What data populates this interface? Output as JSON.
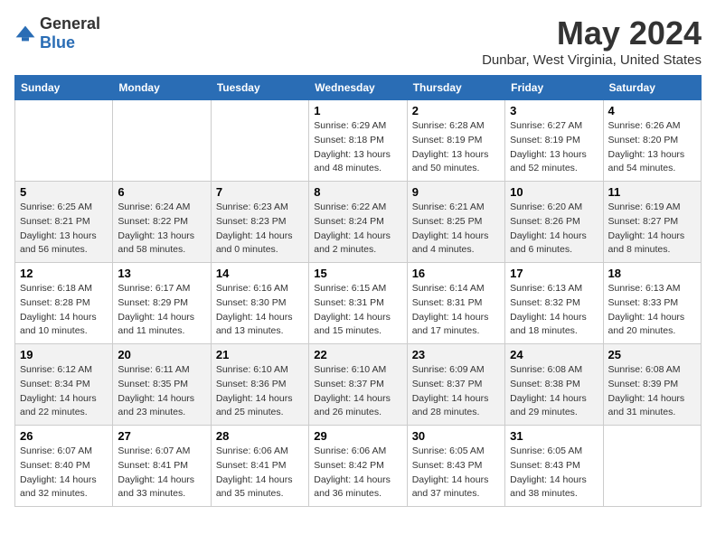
{
  "header": {
    "logo_general": "General",
    "logo_blue": "Blue",
    "title": "May 2024",
    "subtitle": "Dunbar, West Virginia, United States"
  },
  "weekdays": [
    "Sunday",
    "Monday",
    "Tuesday",
    "Wednesday",
    "Thursday",
    "Friday",
    "Saturday"
  ],
  "weeks": [
    [
      {
        "day": "",
        "sunrise": "",
        "sunset": "",
        "daylight": ""
      },
      {
        "day": "",
        "sunrise": "",
        "sunset": "",
        "daylight": ""
      },
      {
        "day": "",
        "sunrise": "",
        "sunset": "",
        "daylight": ""
      },
      {
        "day": "1",
        "sunrise": "Sunrise: 6:29 AM",
        "sunset": "Sunset: 8:18 PM",
        "daylight": "Daylight: 13 hours and 48 minutes."
      },
      {
        "day": "2",
        "sunrise": "Sunrise: 6:28 AM",
        "sunset": "Sunset: 8:19 PM",
        "daylight": "Daylight: 13 hours and 50 minutes."
      },
      {
        "day": "3",
        "sunrise": "Sunrise: 6:27 AM",
        "sunset": "Sunset: 8:19 PM",
        "daylight": "Daylight: 13 hours and 52 minutes."
      },
      {
        "day": "4",
        "sunrise": "Sunrise: 6:26 AM",
        "sunset": "Sunset: 8:20 PM",
        "daylight": "Daylight: 13 hours and 54 minutes."
      }
    ],
    [
      {
        "day": "5",
        "sunrise": "Sunrise: 6:25 AM",
        "sunset": "Sunset: 8:21 PM",
        "daylight": "Daylight: 13 hours and 56 minutes."
      },
      {
        "day": "6",
        "sunrise": "Sunrise: 6:24 AM",
        "sunset": "Sunset: 8:22 PM",
        "daylight": "Daylight: 13 hours and 58 minutes."
      },
      {
        "day": "7",
        "sunrise": "Sunrise: 6:23 AM",
        "sunset": "Sunset: 8:23 PM",
        "daylight": "Daylight: 14 hours and 0 minutes."
      },
      {
        "day": "8",
        "sunrise": "Sunrise: 6:22 AM",
        "sunset": "Sunset: 8:24 PM",
        "daylight": "Daylight: 14 hours and 2 minutes."
      },
      {
        "day": "9",
        "sunrise": "Sunrise: 6:21 AM",
        "sunset": "Sunset: 8:25 PM",
        "daylight": "Daylight: 14 hours and 4 minutes."
      },
      {
        "day": "10",
        "sunrise": "Sunrise: 6:20 AM",
        "sunset": "Sunset: 8:26 PM",
        "daylight": "Daylight: 14 hours and 6 minutes."
      },
      {
        "day": "11",
        "sunrise": "Sunrise: 6:19 AM",
        "sunset": "Sunset: 8:27 PM",
        "daylight": "Daylight: 14 hours and 8 minutes."
      }
    ],
    [
      {
        "day": "12",
        "sunrise": "Sunrise: 6:18 AM",
        "sunset": "Sunset: 8:28 PM",
        "daylight": "Daylight: 14 hours and 10 minutes."
      },
      {
        "day": "13",
        "sunrise": "Sunrise: 6:17 AM",
        "sunset": "Sunset: 8:29 PM",
        "daylight": "Daylight: 14 hours and 11 minutes."
      },
      {
        "day": "14",
        "sunrise": "Sunrise: 6:16 AM",
        "sunset": "Sunset: 8:30 PM",
        "daylight": "Daylight: 14 hours and 13 minutes."
      },
      {
        "day": "15",
        "sunrise": "Sunrise: 6:15 AM",
        "sunset": "Sunset: 8:31 PM",
        "daylight": "Daylight: 14 hours and 15 minutes."
      },
      {
        "day": "16",
        "sunrise": "Sunrise: 6:14 AM",
        "sunset": "Sunset: 8:31 PM",
        "daylight": "Daylight: 14 hours and 17 minutes."
      },
      {
        "day": "17",
        "sunrise": "Sunrise: 6:13 AM",
        "sunset": "Sunset: 8:32 PM",
        "daylight": "Daylight: 14 hours and 18 minutes."
      },
      {
        "day": "18",
        "sunrise": "Sunrise: 6:13 AM",
        "sunset": "Sunset: 8:33 PM",
        "daylight": "Daylight: 14 hours and 20 minutes."
      }
    ],
    [
      {
        "day": "19",
        "sunrise": "Sunrise: 6:12 AM",
        "sunset": "Sunset: 8:34 PM",
        "daylight": "Daylight: 14 hours and 22 minutes."
      },
      {
        "day": "20",
        "sunrise": "Sunrise: 6:11 AM",
        "sunset": "Sunset: 8:35 PM",
        "daylight": "Daylight: 14 hours and 23 minutes."
      },
      {
        "day": "21",
        "sunrise": "Sunrise: 6:10 AM",
        "sunset": "Sunset: 8:36 PM",
        "daylight": "Daylight: 14 hours and 25 minutes."
      },
      {
        "day": "22",
        "sunrise": "Sunrise: 6:10 AM",
        "sunset": "Sunset: 8:37 PM",
        "daylight": "Daylight: 14 hours and 26 minutes."
      },
      {
        "day": "23",
        "sunrise": "Sunrise: 6:09 AM",
        "sunset": "Sunset: 8:37 PM",
        "daylight": "Daylight: 14 hours and 28 minutes."
      },
      {
        "day": "24",
        "sunrise": "Sunrise: 6:08 AM",
        "sunset": "Sunset: 8:38 PM",
        "daylight": "Daylight: 14 hours and 29 minutes."
      },
      {
        "day": "25",
        "sunrise": "Sunrise: 6:08 AM",
        "sunset": "Sunset: 8:39 PM",
        "daylight": "Daylight: 14 hours and 31 minutes."
      }
    ],
    [
      {
        "day": "26",
        "sunrise": "Sunrise: 6:07 AM",
        "sunset": "Sunset: 8:40 PM",
        "daylight": "Daylight: 14 hours and 32 minutes."
      },
      {
        "day": "27",
        "sunrise": "Sunrise: 6:07 AM",
        "sunset": "Sunset: 8:41 PM",
        "daylight": "Daylight: 14 hours and 33 minutes."
      },
      {
        "day": "28",
        "sunrise": "Sunrise: 6:06 AM",
        "sunset": "Sunset: 8:41 PM",
        "daylight": "Daylight: 14 hours and 35 minutes."
      },
      {
        "day": "29",
        "sunrise": "Sunrise: 6:06 AM",
        "sunset": "Sunset: 8:42 PM",
        "daylight": "Daylight: 14 hours and 36 minutes."
      },
      {
        "day": "30",
        "sunrise": "Sunrise: 6:05 AM",
        "sunset": "Sunset: 8:43 PM",
        "daylight": "Daylight: 14 hours and 37 minutes."
      },
      {
        "day": "31",
        "sunrise": "Sunrise: 6:05 AM",
        "sunset": "Sunset: 8:43 PM",
        "daylight": "Daylight: 14 hours and 38 minutes."
      },
      {
        "day": "",
        "sunrise": "",
        "sunset": "",
        "daylight": ""
      }
    ]
  ]
}
